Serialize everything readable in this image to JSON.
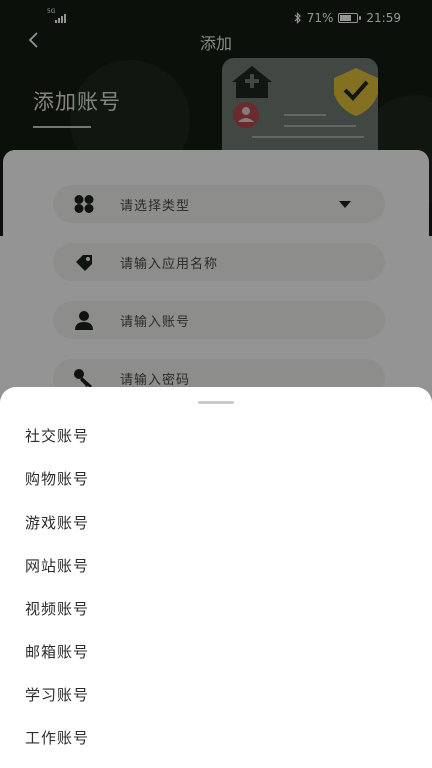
{
  "status_bar": {
    "network": "5G",
    "battery_pct_text": "71%",
    "battery_level": 0.71,
    "time": "21:59"
  },
  "nav": {
    "title": "添加"
  },
  "header": {
    "page_title": "添加账号"
  },
  "form": {
    "type_placeholder": "请选择类型",
    "app_name_placeholder": "请输入应用名称",
    "account_placeholder": "请输入账号",
    "password_placeholder": "请输入密码"
  },
  "sheet": {
    "options": [
      "社交账号",
      "购物账号",
      "游戏账号",
      "网站账号",
      "视频账号",
      "邮箱账号",
      "学习账号",
      "工作账号"
    ]
  },
  "colors": {
    "header_bg": "#141c14",
    "accent_yellow": "#e4c23a",
    "field_bg": "#f3f4f1"
  },
  "icons": [
    "back-arrow-icon",
    "grid-icon",
    "tag-icon",
    "user-icon",
    "key-icon",
    "bluetooth-icon",
    "battery-icon",
    "signal-icon"
  ]
}
